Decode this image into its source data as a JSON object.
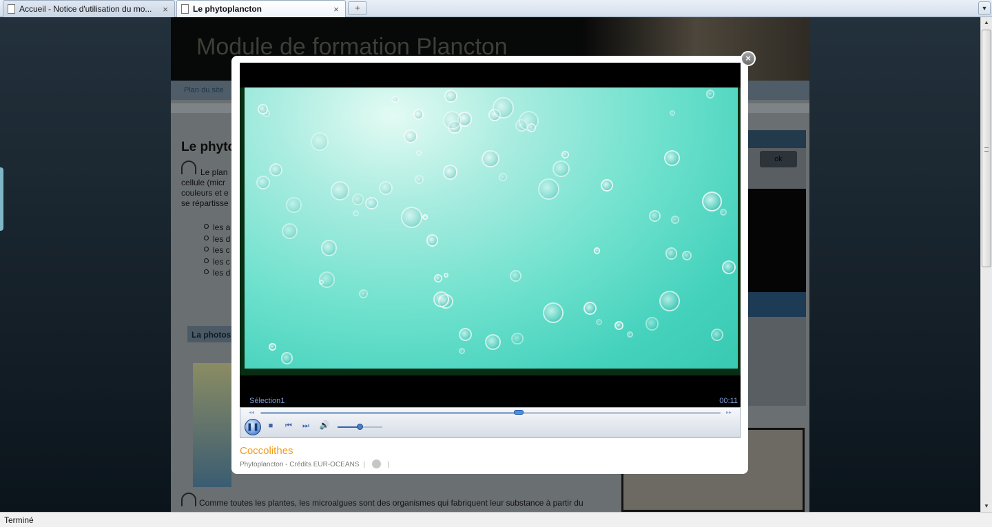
{
  "browser": {
    "tabs": [
      {
        "title": "Accueil - Notice d'utilisation du mo...",
        "close": "×",
        "active": false
      },
      {
        "title": "Le phytoplancton",
        "close": "×",
        "active": true
      }
    ],
    "new_tab": "+",
    "tab_menu": "▼",
    "status": "Terminé"
  },
  "page": {
    "site_title": "Module de formation Plancton",
    "nav_link": "Plan du site",
    "heading": "Le phyto",
    "paragraph": [
      "Le plan",
      "cellule (micr",
      "couleurs et e",
      "se répartisse"
    ],
    "list_items": [
      "les a",
      "les d",
      "les c",
      "les c",
      "les d"
    ],
    "section_button": "La photos",
    "sidebar_ok": "ok",
    "caption": "Comme toutes les plantes, les microalgues sont des organismes qui fabriquent leur substance à partir du"
  },
  "lightbox": {
    "close_label": "×",
    "player": {
      "clip_name": "Sélection1",
      "time": "00:11",
      "progress": 0.56,
      "volume": 0.5,
      "playing": true,
      "icons": {
        "play_pause": "pause-icon",
        "stop": "stop-icon",
        "previous": "previous-icon",
        "next": "next-icon",
        "volume": "speaker-icon"
      },
      "glyphs": {
        "pause": "❚❚",
        "stop": "■",
        "previous": "⏮",
        "next": "⏭",
        "volume": "🔊",
        "rewind": "◂◂",
        "forward": "▸▸"
      }
    },
    "media_title": "Coccolithes",
    "media_credit": "Phytoplancton - Crédits EUR-OCEANS",
    "separator": "|"
  },
  "colors": {
    "accent_title": "#f39a1e",
    "player_text": "#7f9cd9",
    "video_tint": "#45d2bd",
    "seek_fill": "#2e6fd1"
  }
}
